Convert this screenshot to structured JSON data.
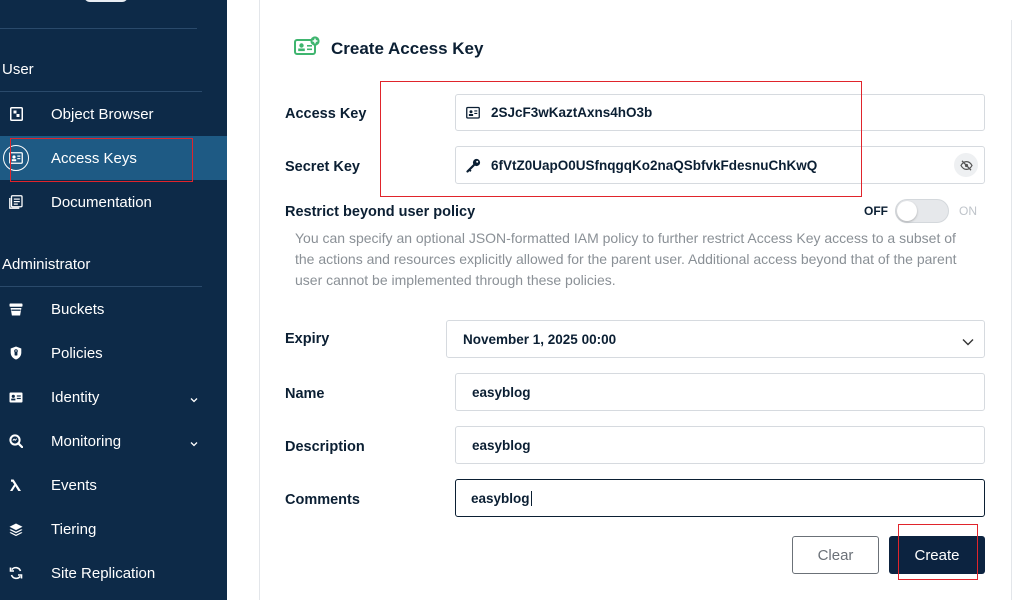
{
  "sidebar": {
    "sections": {
      "user": "User",
      "administrator": "Administrator"
    },
    "user_items": [
      {
        "label": "Object Browser",
        "icon": "object-browser-icon"
      },
      {
        "label": "Access Keys",
        "icon": "access-keys-icon",
        "active": true
      },
      {
        "label": "Documentation",
        "icon": "documentation-icon"
      }
    ],
    "admin_items": [
      {
        "label": "Buckets",
        "icon": "bucket-icon"
      },
      {
        "label": "Policies",
        "icon": "shield-icon"
      },
      {
        "label": "Identity",
        "icon": "id-card-icon",
        "expandable": true
      },
      {
        "label": "Monitoring",
        "icon": "magnifier-icon",
        "expandable": true
      },
      {
        "label": "Events",
        "icon": "lambda-icon"
      },
      {
        "label": "Tiering",
        "icon": "layers-icon"
      },
      {
        "label": "Site Replication",
        "icon": "sync-icon"
      }
    ]
  },
  "form": {
    "title": "Create Access Key",
    "access_key": {
      "label": "Access Key",
      "value": "2SJcF3wKaztAxns4hO3b"
    },
    "secret_key": {
      "label": "Secret Key",
      "value": "6fVtZ0UapO0USfnqgqKo2naQSbfvkFdesnuChKwQ"
    },
    "restrict": {
      "label": "Restrict beyond user policy",
      "off_label": "OFF",
      "on_label": "ON",
      "enabled": false,
      "help": "You can specify an optional JSON-formatted IAM policy to further restrict Access Key access to a subset of the actions and resources explicitly allowed for the parent user. Additional access beyond that of the parent user cannot be implemented through these policies."
    },
    "expiry": {
      "label": "Expiry",
      "value": "November 1, 2025 00:00"
    },
    "name": {
      "label": "Name",
      "value": "easyblog"
    },
    "description": {
      "label": "Description",
      "value": "easyblog"
    },
    "comments": {
      "label": "Comments",
      "value": "easyblog"
    },
    "buttons": {
      "clear": "Clear",
      "create": "Create"
    }
  },
  "colors": {
    "sidebar_bg": "#0d2a48",
    "sidebar_active": "#1e5a84",
    "primary_button": "#0c2340",
    "highlight_box": "#e0242b"
  }
}
